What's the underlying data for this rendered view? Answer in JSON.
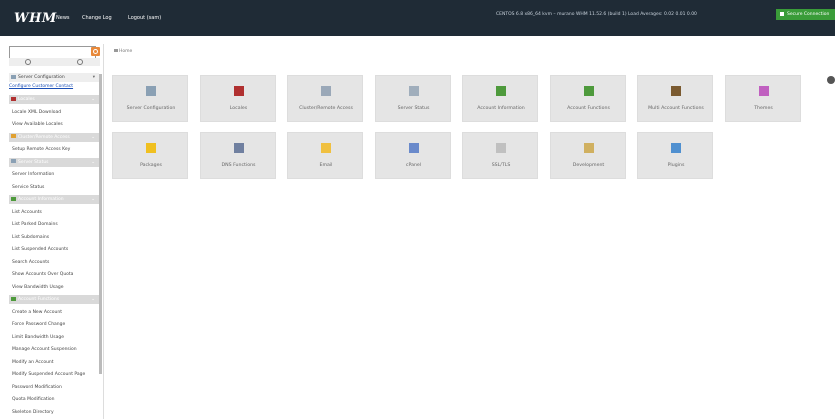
{
  "topbar": {
    "logo": "WHM",
    "nav": [
      "News",
      "Change Log",
      "Logout (sam)"
    ],
    "system_info": "CENTOS 6.8 x86_64 kvm – murano   WHM 11.52.6 (build 1)   Load Averages: 0.02 0.01 0.00",
    "secure_label": "Secure Connection"
  },
  "search": {
    "value": "",
    "placeholder": ""
  },
  "sidebar": {
    "config_section": "Server Configuration",
    "config_link": "Configure Customer Contact",
    "items": [
      {
        "type": "head",
        "label": "Locales",
        "icon_color": "#b03030"
      },
      {
        "type": "item",
        "label": "Locale XML Download"
      },
      {
        "type": "item",
        "label": "View Available Locales"
      },
      {
        "type": "head",
        "label": "Cluster/Remote Access",
        "icon_color": "#e0a030"
      },
      {
        "type": "item",
        "label": "Setup Remote Access Key"
      },
      {
        "type": "head",
        "label": "Server Status",
        "icon_color": "#8aa0b4"
      },
      {
        "type": "item",
        "label": "Server Information"
      },
      {
        "type": "item",
        "label": "Service Status"
      },
      {
        "type": "head",
        "label": "Account Information",
        "icon_color": "#4e9a3c"
      },
      {
        "type": "item",
        "label": "List Accounts"
      },
      {
        "type": "item",
        "label": "List Parked Domains"
      },
      {
        "type": "item",
        "label": "List Subdomains"
      },
      {
        "type": "item",
        "label": "List Suspended Accounts"
      },
      {
        "type": "item",
        "label": "Search Accounts"
      },
      {
        "type": "item",
        "label": "Show Accounts Over Quota"
      },
      {
        "type": "item",
        "label": "View Bandwidth Usage"
      },
      {
        "type": "head",
        "label": "Account Functions",
        "icon_color": "#4e9a3c"
      },
      {
        "type": "item",
        "label": "Create a New Account"
      },
      {
        "type": "item",
        "label": "Force Password Change"
      },
      {
        "type": "item",
        "label": "Limit Bandwidth Usage"
      },
      {
        "type": "item",
        "label": "Manage Account Suspension"
      },
      {
        "type": "item",
        "label": "Modify an Account"
      },
      {
        "type": "item",
        "label": "Modify Suspended Account Page"
      },
      {
        "type": "item",
        "label": "Password Modification"
      },
      {
        "type": "item",
        "label": "Quota Modification"
      },
      {
        "type": "item",
        "label": "Skeleton Directory"
      }
    ]
  },
  "breadcrumb": "Home",
  "tiles": [
    {
      "label": "Server Configuration",
      "icon": "server-config-icon",
      "color": "#8aa0b4"
    },
    {
      "label": "Locales",
      "icon": "locales-icon",
      "color": "#b03030"
    },
    {
      "label": "Cluster/Remote Access",
      "icon": "cluster-icon",
      "color": "#9aa8b8"
    },
    {
      "label": "Server Status",
      "icon": "server-status-icon",
      "color": "#a0aebc"
    },
    {
      "label": "Account Information",
      "icon": "account-info-icon",
      "color": "#4e9a3c"
    },
    {
      "label": "Account Functions",
      "icon": "account-functions-icon",
      "color": "#4e9a3c"
    },
    {
      "label": "Multi Account Functions",
      "icon": "multi-account-icon",
      "color": "#7a5a30"
    },
    {
      "label": "Themes",
      "icon": "themes-icon",
      "color": "#c060c0"
    },
    {
      "label": "Packages",
      "icon": "packages-icon",
      "color": "#f0c020"
    },
    {
      "label": "DNS Functions",
      "icon": "dns-icon",
      "color": "#7080a0"
    },
    {
      "label": "Email",
      "icon": "email-icon",
      "color": "#f0c040"
    },
    {
      "label": "cPanel",
      "icon": "cpanel-icon",
      "color": "#6a8acb"
    },
    {
      "label": "SSL/TLS",
      "icon": "ssl-icon",
      "color": "#c0c0c0"
    },
    {
      "label": "Development",
      "icon": "development-icon",
      "color": "#d0b060"
    },
    {
      "label": "Plugins",
      "icon": "plugins-icon",
      "color": "#5090d0"
    }
  ]
}
